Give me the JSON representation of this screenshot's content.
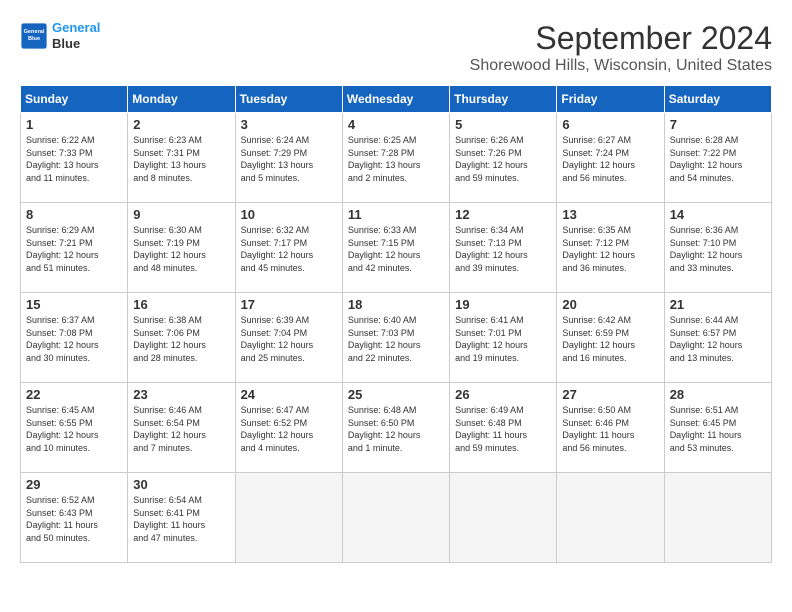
{
  "logo": {
    "line1": "General",
    "line2": "Blue"
  },
  "title": "September 2024",
  "location": "Shorewood Hills, Wisconsin, United States",
  "days_of_week": [
    "Sunday",
    "Monday",
    "Tuesday",
    "Wednesday",
    "Thursday",
    "Friday",
    "Saturday"
  ],
  "weeks": [
    [
      {
        "num": "1",
        "info": "Sunrise: 6:22 AM\nSunset: 7:33 PM\nDaylight: 13 hours\nand 11 minutes."
      },
      {
        "num": "2",
        "info": "Sunrise: 6:23 AM\nSunset: 7:31 PM\nDaylight: 13 hours\nand 8 minutes."
      },
      {
        "num": "3",
        "info": "Sunrise: 6:24 AM\nSunset: 7:29 PM\nDaylight: 13 hours\nand 5 minutes."
      },
      {
        "num": "4",
        "info": "Sunrise: 6:25 AM\nSunset: 7:28 PM\nDaylight: 13 hours\nand 2 minutes."
      },
      {
        "num": "5",
        "info": "Sunrise: 6:26 AM\nSunset: 7:26 PM\nDaylight: 12 hours\nand 59 minutes."
      },
      {
        "num": "6",
        "info": "Sunrise: 6:27 AM\nSunset: 7:24 PM\nDaylight: 12 hours\nand 56 minutes."
      },
      {
        "num": "7",
        "info": "Sunrise: 6:28 AM\nSunset: 7:22 PM\nDaylight: 12 hours\nand 54 minutes."
      }
    ],
    [
      {
        "num": "8",
        "info": "Sunrise: 6:29 AM\nSunset: 7:21 PM\nDaylight: 12 hours\nand 51 minutes."
      },
      {
        "num": "9",
        "info": "Sunrise: 6:30 AM\nSunset: 7:19 PM\nDaylight: 12 hours\nand 48 minutes."
      },
      {
        "num": "10",
        "info": "Sunrise: 6:32 AM\nSunset: 7:17 PM\nDaylight: 12 hours\nand 45 minutes."
      },
      {
        "num": "11",
        "info": "Sunrise: 6:33 AM\nSunset: 7:15 PM\nDaylight: 12 hours\nand 42 minutes."
      },
      {
        "num": "12",
        "info": "Sunrise: 6:34 AM\nSunset: 7:13 PM\nDaylight: 12 hours\nand 39 minutes."
      },
      {
        "num": "13",
        "info": "Sunrise: 6:35 AM\nSunset: 7:12 PM\nDaylight: 12 hours\nand 36 minutes."
      },
      {
        "num": "14",
        "info": "Sunrise: 6:36 AM\nSunset: 7:10 PM\nDaylight: 12 hours\nand 33 minutes."
      }
    ],
    [
      {
        "num": "15",
        "info": "Sunrise: 6:37 AM\nSunset: 7:08 PM\nDaylight: 12 hours\nand 30 minutes."
      },
      {
        "num": "16",
        "info": "Sunrise: 6:38 AM\nSunset: 7:06 PM\nDaylight: 12 hours\nand 28 minutes."
      },
      {
        "num": "17",
        "info": "Sunrise: 6:39 AM\nSunset: 7:04 PM\nDaylight: 12 hours\nand 25 minutes."
      },
      {
        "num": "18",
        "info": "Sunrise: 6:40 AM\nSunset: 7:03 PM\nDaylight: 12 hours\nand 22 minutes."
      },
      {
        "num": "19",
        "info": "Sunrise: 6:41 AM\nSunset: 7:01 PM\nDaylight: 12 hours\nand 19 minutes."
      },
      {
        "num": "20",
        "info": "Sunrise: 6:42 AM\nSunset: 6:59 PM\nDaylight: 12 hours\nand 16 minutes."
      },
      {
        "num": "21",
        "info": "Sunrise: 6:44 AM\nSunset: 6:57 PM\nDaylight: 12 hours\nand 13 minutes."
      }
    ],
    [
      {
        "num": "22",
        "info": "Sunrise: 6:45 AM\nSunset: 6:55 PM\nDaylight: 12 hours\nand 10 minutes."
      },
      {
        "num": "23",
        "info": "Sunrise: 6:46 AM\nSunset: 6:54 PM\nDaylight: 12 hours\nand 7 minutes."
      },
      {
        "num": "24",
        "info": "Sunrise: 6:47 AM\nSunset: 6:52 PM\nDaylight: 12 hours\nand 4 minutes."
      },
      {
        "num": "25",
        "info": "Sunrise: 6:48 AM\nSunset: 6:50 PM\nDaylight: 12 hours\nand 1 minute."
      },
      {
        "num": "26",
        "info": "Sunrise: 6:49 AM\nSunset: 6:48 PM\nDaylight: 11 hours\nand 59 minutes."
      },
      {
        "num": "27",
        "info": "Sunrise: 6:50 AM\nSunset: 6:46 PM\nDaylight: 11 hours\nand 56 minutes."
      },
      {
        "num": "28",
        "info": "Sunrise: 6:51 AM\nSunset: 6:45 PM\nDaylight: 11 hours\nand 53 minutes."
      }
    ],
    [
      {
        "num": "29",
        "info": "Sunrise: 6:52 AM\nSunset: 6:43 PM\nDaylight: 11 hours\nand 50 minutes."
      },
      {
        "num": "30",
        "info": "Sunrise: 6:54 AM\nSunset: 6:41 PM\nDaylight: 11 hours\nand 47 minutes."
      },
      {
        "num": "",
        "info": ""
      },
      {
        "num": "",
        "info": ""
      },
      {
        "num": "",
        "info": ""
      },
      {
        "num": "",
        "info": ""
      },
      {
        "num": "",
        "info": ""
      }
    ]
  ]
}
